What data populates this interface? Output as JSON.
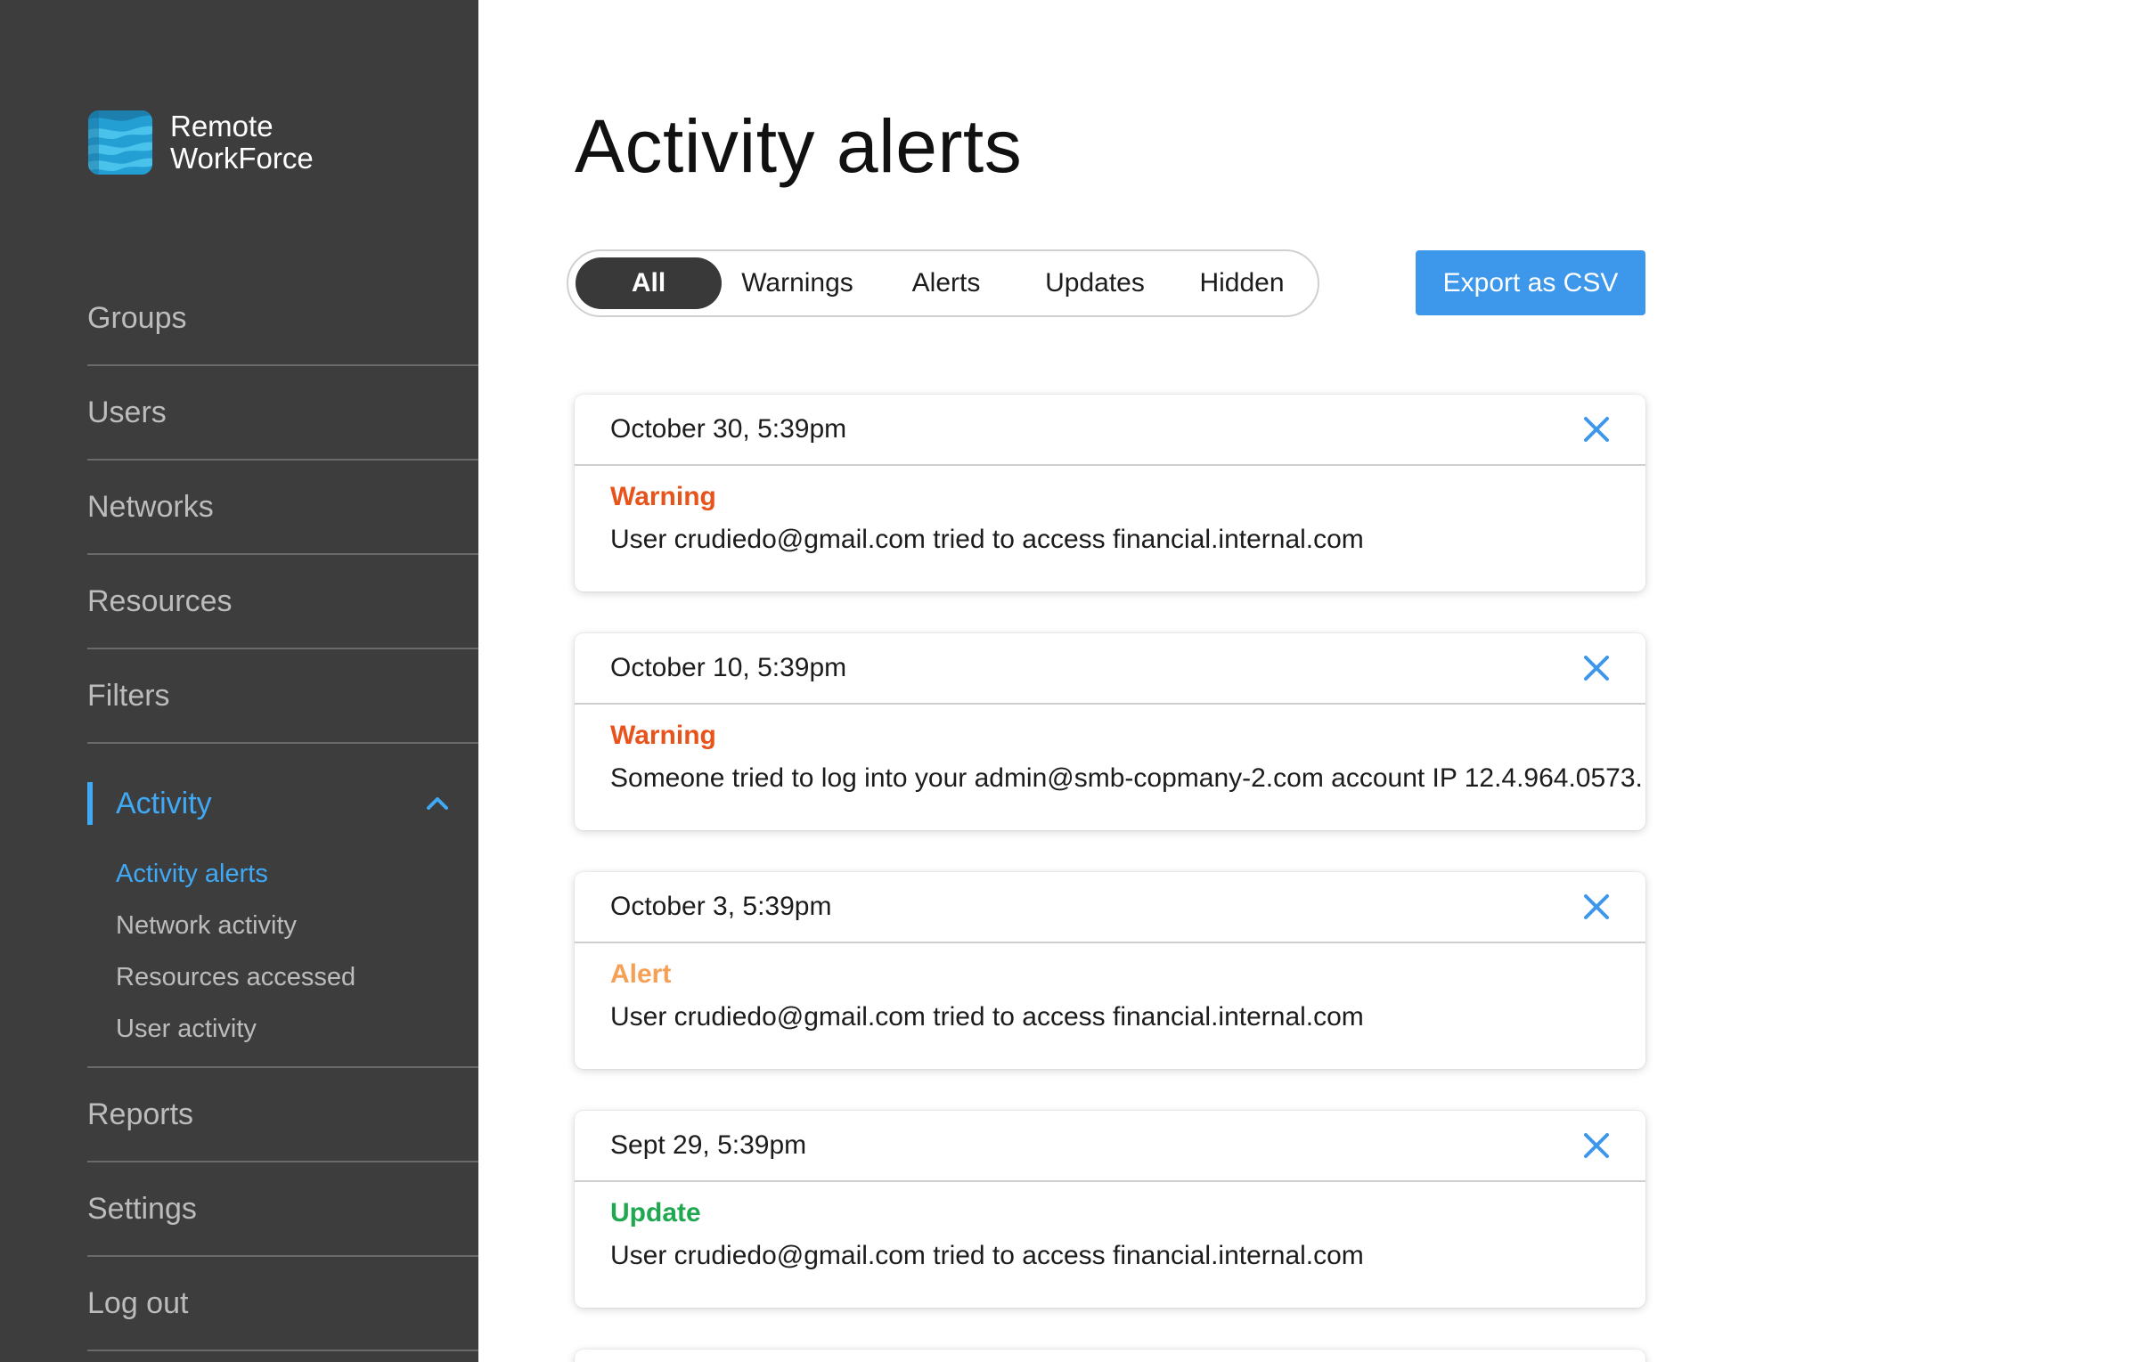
{
  "brand": {
    "line1": "Remote",
    "line2": "WorkForce"
  },
  "nav": {
    "items_top": [
      {
        "label": "Groups"
      },
      {
        "label": "Users"
      },
      {
        "label": "Networks"
      },
      {
        "label": "Resources"
      },
      {
        "label": "Filters"
      }
    ],
    "active": {
      "label": "Activity",
      "sub": [
        {
          "label": "Activity alerts"
        },
        {
          "label": "Network activity"
        },
        {
          "label": "Resources accessed"
        },
        {
          "label": "User activity"
        }
      ]
    },
    "items_bottom": [
      {
        "label": "Reports"
      },
      {
        "label": "Settings"
      },
      {
        "label": "Log out"
      }
    ]
  },
  "page": {
    "title": "Activity alerts"
  },
  "filters": {
    "all": "All",
    "warnings": "Warnings",
    "alerts": "Alerts",
    "updates": "Updates",
    "hidden": "Hidden",
    "selected": "All"
  },
  "export_label": "Export as CSV",
  "alerts": [
    {
      "date": "October 30, 5:39pm",
      "type": "Warning",
      "message": "User crudiedo@gmail.com tried to access financial.internal.com"
    },
    {
      "date": "October 10, 5:39pm",
      "type": "Warning",
      "message": "Someone tried to log into your admin@smb-copmany-2.com account IP 12.4.964.0573."
    },
    {
      "date": "October 3, 5:39pm",
      "type": "Alert",
      "message": "User crudiedo@gmail.com tried to access financial.internal.com"
    },
    {
      "date": "Sept 29, 5:39pm",
      "type": "Update",
      "message": "User crudiedo@gmail.com tried to access financial.internal.com"
    }
  ],
  "colors": {
    "sidebar_bg": "#3e3d3e",
    "accent_blue": "#3fa9f5",
    "button_blue": "#3d97ea",
    "warning": "#e8531c",
    "alert": "#f5a054",
    "update": "#1fa84f"
  },
  "icons": {
    "logo": "stacked-waves-logo",
    "chevron": "chevron-up-icon",
    "close": "close-x-icon"
  }
}
